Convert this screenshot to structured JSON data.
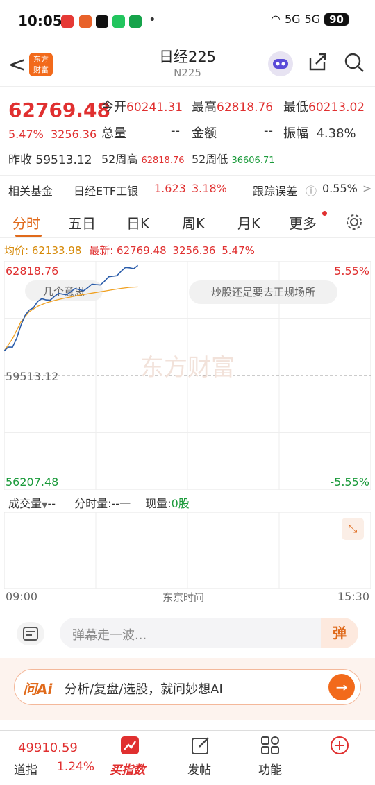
{
  "status": {
    "time": "10:05",
    "signal1": "5G",
    "signal2": "5G",
    "battery": "90"
  },
  "nav": {
    "back": "<",
    "logo": "东方\n财富",
    "title": "日经225",
    "subtitle": "N225"
  },
  "quote": {
    "price": "62769.48",
    "pct": "5.47%",
    "chg": "3256.36",
    "prev_label": "昨收",
    "prev": "59513.12",
    "open_label": "今开",
    "open": "60241.31",
    "high_label": "最高",
    "high": "62818.76",
    "low_label": "最低",
    "low": "60213.02",
    "vol_label": "总量",
    "vol": "--",
    "amt_label": "金额",
    "amt": "--",
    "amp_label": "振幅",
    "amp": "4.38%",
    "w52h_label": "52周高",
    "w52h": "62818.76",
    "w52l_label": "52周低",
    "w52l": "36606.71"
  },
  "fund": {
    "label": "相关基金",
    "name": "日经ETF工银",
    "price": "1.623",
    "pct": "3.18%",
    "track_label": "跟踪误差",
    "track": "0.55%",
    "chevron": ">"
  },
  "tabs": [
    "分时",
    "五日",
    "日K",
    "周K",
    "月K",
    "更多"
  ],
  "avg": {
    "avg_label": "均价:",
    "avg": "62133.98",
    "last_label": "最新:",
    "last": "62769.48",
    "chg": "3256.36",
    "pct": "5.47%"
  },
  "chart_data": {
    "type": "line",
    "x_start": "09:00",
    "x_end": "15:30",
    "x_mid_label": "东京时间",
    "ylim": [
      56207.48,
      62818.76
    ],
    "y_top": "62818.76",
    "y_mid": "59513.12",
    "y_bottom": "56207.48",
    "pct_top": "5.55%",
    "pct_bottom": "-5.55%",
    "series": [
      {
        "values": [
          60241,
          60350,
          61000,
          61450,
          61700,
          61750,
          61850,
          61920,
          62000,
          62050,
          62110,
          62200,
          62300,
          62450,
          62600,
          62700,
          62769
        ]
      },
      {
        "values": [
          60241,
          60600,
          61100,
          61400,
          61560,
          61660,
          61730,
          61790,
          61840,
          61890,
          61930,
          61970,
          62010,
          62050,
          62090,
          62120,
          62134
        ]
      }
    ],
    "x_fraction_elapsed": 0.38,
    "bubbles": [
      "几个意思",
      "炒股还是要去正规场所"
    ],
    "watermark": "东方财富"
  },
  "volume": {
    "label": "成交量",
    "dd": "▼",
    "dash": "--",
    "fs_label": "分时量:",
    "fs": "--一",
    "xl_label": "现量:",
    "xl": "0股"
  },
  "danmu": {
    "placeholder": "弹幕走一波...",
    "btn": "弹"
  },
  "ai": {
    "logo": "问Ai",
    "text": "分析/复盘/选股，就问妙想AI",
    "go": "→"
  },
  "bottom": {
    "dow_price": "49910.59",
    "dow_label": "道指",
    "dow_pct": "1.24%",
    "buy": "买指数",
    "post": "发帖",
    "func": "功能"
  },
  "colors": {
    "up": "#e03030",
    "down": "#1a9a3a",
    "accent": "#e06a1b",
    "price_line": "#2a5caa",
    "avg_line": "#f0a020"
  }
}
